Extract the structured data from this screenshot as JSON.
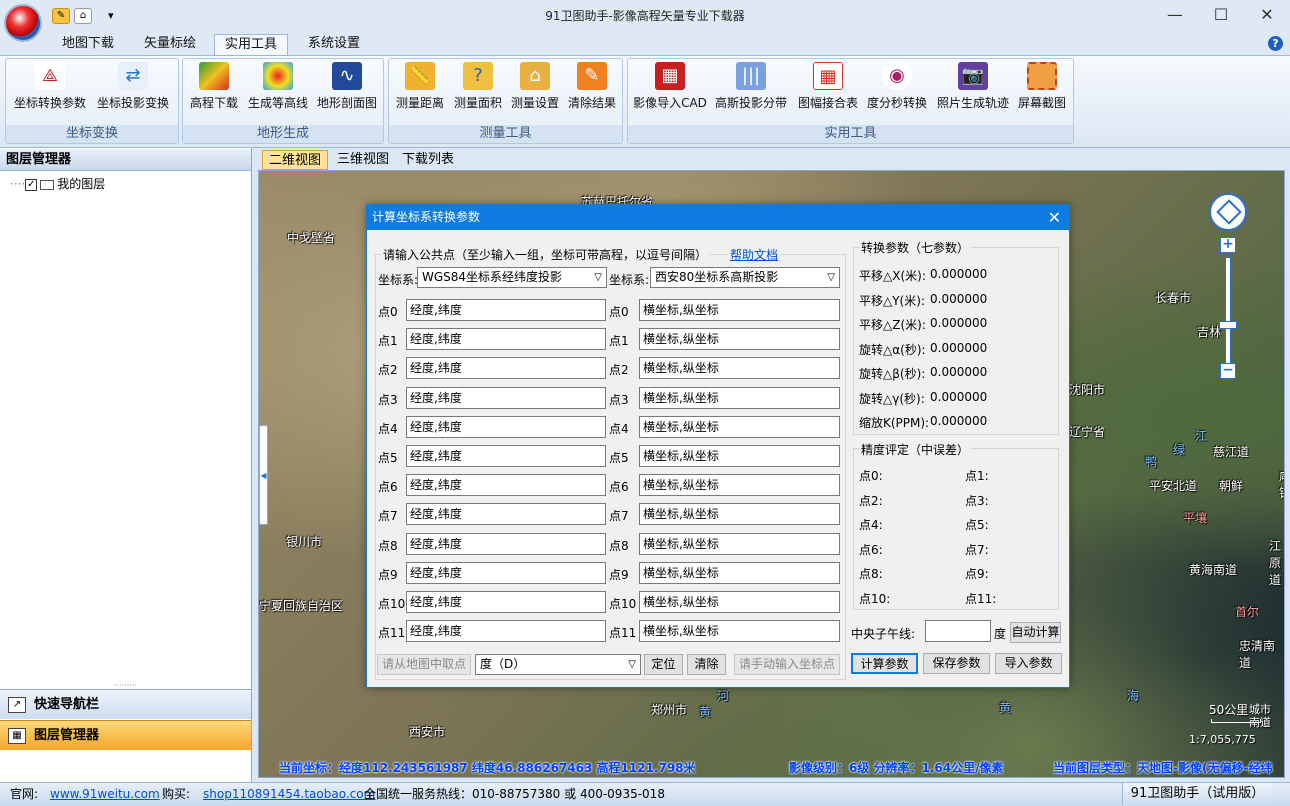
{
  "window": {
    "title": "91卫图助手-影像高程矢量专业下载器"
  },
  "quick_access": {
    "icon1": "tag-icon",
    "icon2": "home-icon",
    "menu": "▾"
  },
  "ribbon_tabs": [
    "地图下载",
    "矢量标绘",
    "实用工具",
    "系统设置"
  ],
  "ribbon": {
    "groups": [
      {
        "label": "坐标变换",
        "buttons": [
          "坐标转换参数",
          "坐标投影变换"
        ]
      },
      {
        "label": "地形生成",
        "buttons": [
          "高程下载",
          "生成等高线",
          "地形剖面图"
        ]
      },
      {
        "label": "测量工具",
        "buttons": [
          "测量距离",
          "测量面积",
          "测量设置",
          "清除结果"
        ]
      },
      {
        "label": "实用工具",
        "buttons": [
          "影像导入CAD",
          "高斯投影分带",
          "图幅接合表",
          "度分秒转换",
          "照片生成轨迹",
          "屏幕截图"
        ]
      }
    ]
  },
  "left_panel": {
    "title": "图层管理器",
    "tree_root": "我的图层",
    "nav_quick": "快速导航栏",
    "nav_layers": "图层管理器"
  },
  "map_tabs": [
    "二维视图",
    "三维视图",
    "下载列表"
  ],
  "map": {
    "labels": [
      {
        "text": "苏赫巴托尔省",
        "cls": ""
      },
      {
        "text": "中戈壁省",
        "cls": ""
      },
      {
        "text": "银川市",
        "cls": ""
      },
      {
        "text": "宁夏回族自治区",
        "cls": ""
      },
      {
        "text": "西安市",
        "cls": ""
      },
      {
        "text": "郑州市",
        "cls": ""
      },
      {
        "text": "长春市",
        "cls": ""
      },
      {
        "text": "吉林",
        "cls": ""
      },
      {
        "text": "沈阳市",
        "cls": ""
      },
      {
        "text": "辽宁省",
        "cls": ""
      },
      {
        "text": "慈江道",
        "cls": ""
      },
      {
        "text": "平安北道",
        "cls": ""
      },
      {
        "text": "朝鲜",
        "cls": ""
      },
      {
        "text": "平壤",
        "cls": "r"
      },
      {
        "text": "江原道",
        "cls": ""
      },
      {
        "text": "黄海南道",
        "cls": ""
      },
      {
        "text": "首尔",
        "cls": "r"
      },
      {
        "text": "忠清南道",
        "cls": ""
      },
      {
        "text": "咸镜",
        "cls": ""
      },
      {
        "text": "市",
        "cls": ""
      },
      {
        "text": "鸭",
        "cls": "b"
      },
      {
        "text": "绿",
        "cls": "b"
      },
      {
        "text": "江",
        "cls": "b"
      },
      {
        "text": "河",
        "cls": "b"
      },
      {
        "text": "黄",
        "cls": "b"
      },
      {
        "text": "黄",
        "cls": "b"
      },
      {
        "text": "海",
        "cls": "b"
      }
    ],
    "scale_text": "50公里",
    "scale_sub": "城市",
    "scale_sub2": "南道",
    "ratio": "1:7,055,775",
    "status_coord": "当前坐标：经度112.243561987 纬度46.886267463 高程1121.798米",
    "status_level": "影像级别：6级 分辨率：1.64公里/像素",
    "status_layer": "当前图层类型：天地图-影像(无偏移-经纬"
  },
  "dialog": {
    "title": "计算坐标系转换参数",
    "prompt": "请输入公共点（至少输入一组，坐标可带高程，以逗号间隔）",
    "help_link": "帮助文档",
    "crs_label": "坐标系:",
    "src_crs": "WGS84坐标系经纬度投影",
    "dst_crs": "西安80坐标系高斯投影",
    "points": [
      "点0",
      "点1",
      "点2",
      "点3",
      "点4",
      "点5",
      "点6",
      "点7",
      "点8",
      "点9",
      "点10",
      "点11"
    ],
    "src_placeholder": "经度,纬度",
    "dst_placeholder": "横坐标,纵坐标",
    "btn_pick": "请从地图中取点",
    "unit_select": "度（D）",
    "btn_locate": "定位",
    "btn_clear": "清除",
    "btn_manual": "请手动输入坐标点",
    "params_title": "转换参数（七参数）",
    "params": [
      {
        "label": "平移△X(米):",
        "value": "0.000000"
      },
      {
        "label": "平移△Y(米):",
        "value": "0.000000"
      },
      {
        "label": "平移△Z(米):",
        "value": "0.000000"
      },
      {
        "label": "旋转△α(秒):",
        "value": "0.000000"
      },
      {
        "label": "旋转△β(秒):",
        "value": "0.000000"
      },
      {
        "label": "旋转△γ(秒):",
        "value": "0.000000"
      },
      {
        "label": "缩放K(PPM):",
        "value": "0.000000"
      }
    ],
    "precision_title": "精度评定（中误差）",
    "precision_left": [
      "点0:",
      "点2:",
      "点4:",
      "点6:",
      "点8:",
      "点10:"
    ],
    "precision_right": [
      "点1:",
      "点3:",
      "点5:",
      "点7:",
      "点9:",
      "点11:"
    ],
    "meridian_label": "中央子午线:",
    "meridian_unit": "度",
    "btn_auto": "自动计算",
    "btn_calc": "计算参数",
    "btn_save": "保存参数",
    "btn_import": "导入参数"
  },
  "statusbar": {
    "site_label": "官网:",
    "site": "www.91weitu.com",
    "buy_label": "购买:",
    "shop": "shop110891454.taobao.com",
    "hotline": "全国统一服务热线：010-88757380 或 400-0935-018",
    "right": "91卫图助手（试用版）"
  },
  "colors": {
    "accent": "#0d7be0",
    "ribbon_bg": "#dfe9f5",
    "nav_active": "#f4a52b"
  }
}
